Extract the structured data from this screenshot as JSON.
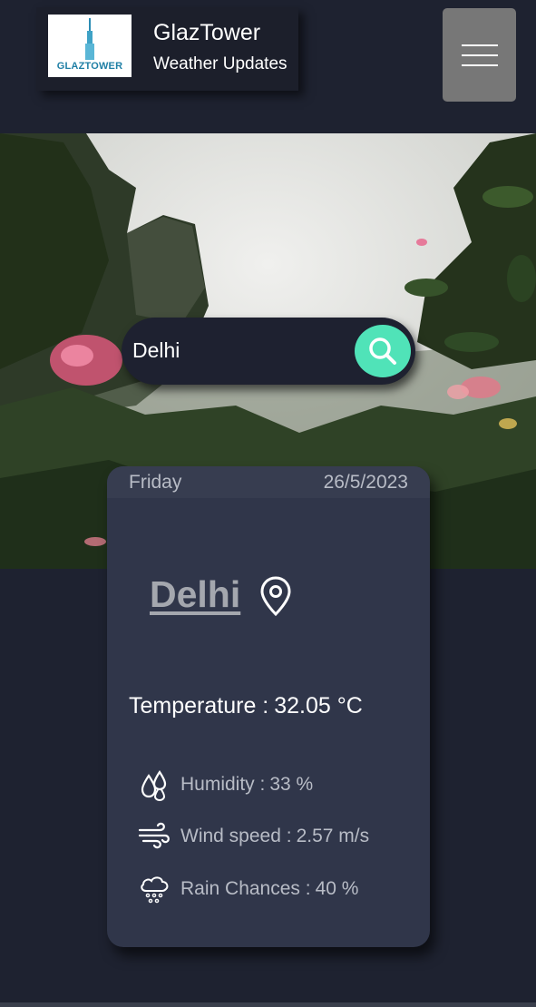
{
  "header": {
    "logo_text": "GLAZTOWER",
    "title": "GlazTower",
    "subtitle": "Weather Updates",
    "menu_icon": "hamburger-menu-icon"
  },
  "search": {
    "value": "Delhi",
    "button_icon": "search-icon",
    "accent_color": "#50e3b8"
  },
  "card": {
    "day": "Friday",
    "date": "26/5/2023",
    "city": "Delhi",
    "city_icon": "location-pin-icon",
    "temperature_label": "Temperature :",
    "temperature_value": "32.05 °C",
    "details": [
      {
        "icon": "humidity-drops-icon",
        "label": "Humidity :",
        "value": "33 %"
      },
      {
        "icon": "wind-icon",
        "label": "Wind speed :",
        "value": "2.57 m/s"
      },
      {
        "icon": "rain-cloud-icon",
        "label": "Rain Chances :",
        "value": "40 %"
      }
    ]
  },
  "colors": {
    "background": "#1e2230",
    "card": "#30364a",
    "menu_button": "#777777"
  }
}
